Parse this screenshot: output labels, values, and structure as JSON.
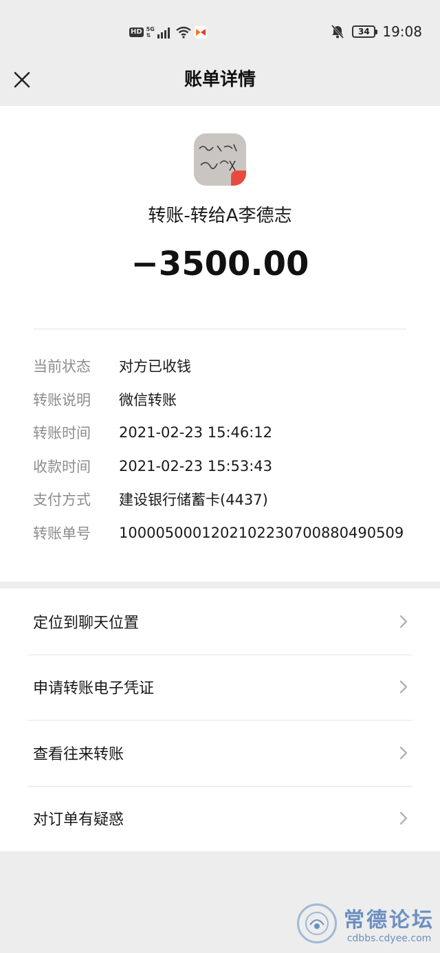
{
  "status_bar": {
    "hd": "HD",
    "network": "5G",
    "time": "19:08",
    "battery": "34"
  },
  "nav": {
    "title": "账单详情",
    "close_icon": "close-icon"
  },
  "header": {
    "title": "转账-转给A李德志",
    "amount": "−3500.00"
  },
  "details": [
    {
      "label": "当前状态",
      "value": "对方已收钱"
    },
    {
      "label": "转账说明",
      "value": "微信转账"
    },
    {
      "label": "转账时间",
      "value": "2021-02-23 15:46:12"
    },
    {
      "label": "收款时间",
      "value": "2021-02-23 15:53:43"
    },
    {
      "label": "支付方式",
      "value": "建设银行储蓄卡(4437)"
    },
    {
      "label": "转账单号",
      "value": "100005000120210223070088049050​9"
    }
  ],
  "actions": [
    {
      "label": "定位到聊天位置"
    },
    {
      "label": "申请转账电子凭证"
    },
    {
      "label": "查看往来转账"
    },
    {
      "label": "对订单有疑惑"
    }
  ],
  "watermark": {
    "title": "常德论坛",
    "subtitle": "cdbbs.cdyee.com"
  },
  "colors": {
    "background": "#ededed",
    "card": "#ffffff",
    "label_gray": "#8c8c8c",
    "text": "#191919"
  }
}
